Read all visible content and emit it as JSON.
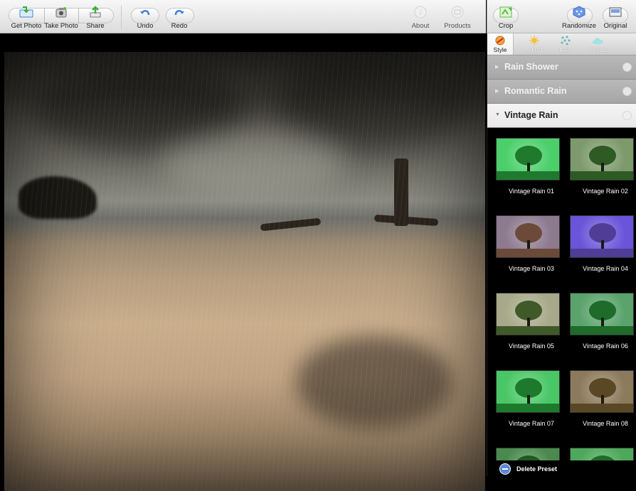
{
  "toolbar": {
    "get_photo": "Get Photo",
    "take_photo": "Take Photo",
    "share": "Share",
    "undo": "Undo",
    "redo": "Redo",
    "about": "About",
    "products": "Products"
  },
  "right_toolbar": {
    "crop": "Crop",
    "randomize": "Randomize",
    "original": "Original"
  },
  "tabs": [
    "Style",
    "Adjust",
    "Rain",
    "Clouds"
  ],
  "sections": [
    {
      "title": "Rain Shower",
      "open": false
    },
    {
      "title": "Romantic Rain",
      "open": false
    },
    {
      "title": "Vintage Rain",
      "open": true
    }
  ],
  "presets": [
    {
      "label": "Vintage Rain 01",
      "bg": "#4ccf6b",
      "tree": "#1f7a2e"
    },
    {
      "label": "Vintage Rain 02",
      "bg": "#7d9a6c",
      "tree": "#2e5a24"
    },
    {
      "label": "Vintage Rain 03",
      "bg": "#8d7a8f",
      "tree": "#6b4a3a"
    },
    {
      "label": "Vintage Rain 04",
      "bg": "#6a54d9",
      "tree": "#4f3d96"
    },
    {
      "label": "Vintage Rain 05",
      "bg": "#a8a88a",
      "tree": "#3f5a28"
    },
    {
      "label": "Vintage Rain 06",
      "bg": "#5aa36c",
      "tree": "#1e6b2a"
    },
    {
      "label": "Vintage Rain 07",
      "bg": "#49c766",
      "tree": "#1d7a2c"
    },
    {
      "label": "Vintage Rain 08",
      "bg": "#8c7a5c",
      "tree": "#5a4824"
    },
    {
      "label": "",
      "bg": "#4a8a4e",
      "tree": "#1e5a22"
    },
    {
      "label": "",
      "bg": "#4ea85a",
      "tree": "#1e6b2a"
    }
  ],
  "delete_preset": "Delete Preset",
  "colors": {
    "accent_blue": "#3f7fd6",
    "accent_green": "#5cbf3a"
  }
}
